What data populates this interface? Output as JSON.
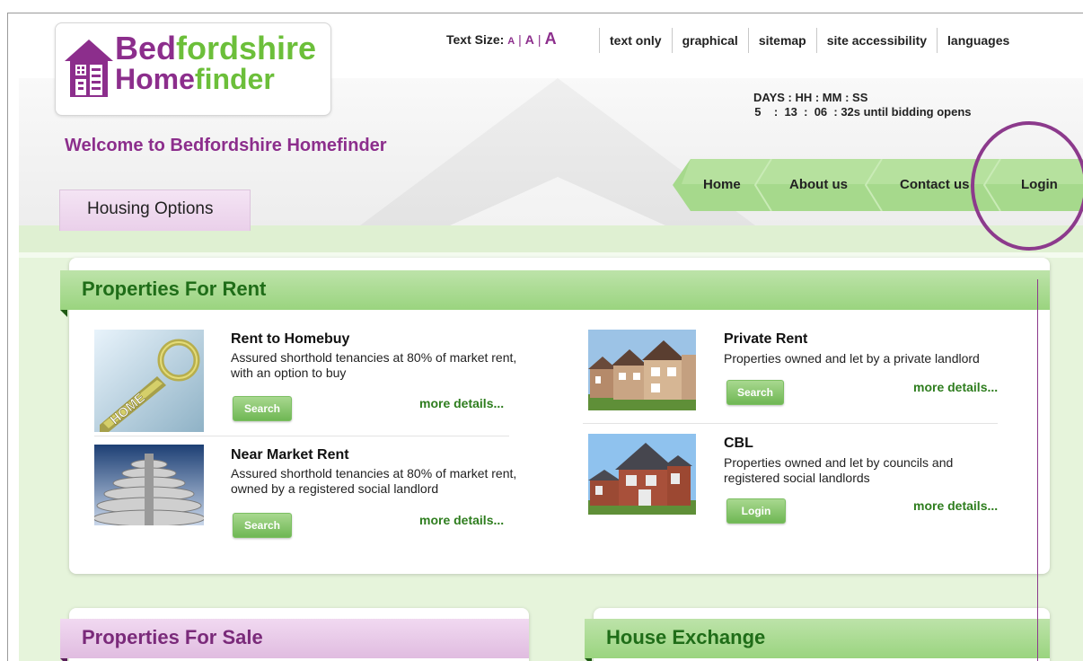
{
  "logo": {
    "line1_part1": "Bed",
    "line1_part2": "fordshire",
    "line2_part1": "Home",
    "line2_part2": "finder"
  },
  "text_size": {
    "label": "Text Size:",
    "small": "A",
    "medium": "A",
    "large": "A",
    "separator": "|"
  },
  "top_links": [
    "text only",
    "graphical",
    "sitemap",
    "site accessibility",
    "languages"
  ],
  "countdown": {
    "header": "DAYS : HH : MM : SS",
    "values": "  5    :  13  :  06  : 32s until bidding opens"
  },
  "welcome": "Welcome to Bedfordshire Homefinder",
  "housing_tab": "Housing Options",
  "main_nav": [
    "Home",
    "About us",
    "Contact us",
    "Login"
  ],
  "colors": {
    "brand_purple": "#8c2e8c",
    "brand_green": "#6cbf3a",
    "panel_green": "#9ad47f",
    "panel_purple": "#e0bce0"
  },
  "rent_panel": {
    "title": "Properties For Rent",
    "items": [
      {
        "title": "Rent to Homebuy",
        "desc": "Assured shorthold tenancies at 80% of market rent, with an option to buy",
        "button": "Search",
        "more": "more details..."
      },
      {
        "title": "Near Market Rent",
        "desc": "Assured shorthold tenancies at 80% of market rent, owned by a registered social landlord",
        "button": "Search",
        "more": "more details..."
      },
      {
        "title": "Private Rent",
        "desc": "Properties owned and let by a private landlord",
        "button": "Search",
        "more": "more details..."
      },
      {
        "title": "CBL",
        "desc": "Properties owned and let by councils and registered social landlords",
        "button": "Login",
        "more": "more details..."
      }
    ]
  },
  "sale_panel": {
    "title": "Properties For Sale"
  },
  "exchange_panel": {
    "title": "House Exchange"
  }
}
